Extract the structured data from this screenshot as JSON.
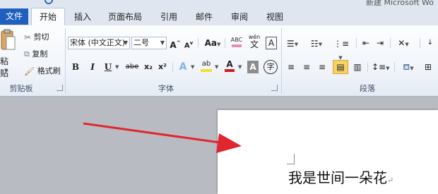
{
  "window": {
    "title": "新建 Microsoft Wo"
  },
  "tabs": [
    {
      "label": "文件"
    },
    {
      "label": "开始"
    },
    {
      "label": "插入"
    },
    {
      "label": "页面布局"
    },
    {
      "label": "引用"
    },
    {
      "label": "邮件"
    },
    {
      "label": "审阅"
    },
    {
      "label": "视图"
    }
  ],
  "clipboard": {
    "paste_label": "粘贴",
    "cut": "剪切",
    "copy": "复制",
    "format_painter": "格式刷",
    "group_label": "剪贴板"
  },
  "font": {
    "font_name": "宋体 (中文正文)",
    "font_size": "二号",
    "grow": "A",
    "shrink": "A",
    "change_case": "Aa",
    "clear_format": "ABC",
    "phonetic": "wén",
    "border_char": "A",
    "bold": "B",
    "italic": "I",
    "underline": "U",
    "strike": "abe",
    "subscript": "x₂",
    "superscript": "x²",
    "text_effect": "A",
    "highlight": "ab",
    "font_color": "A",
    "char_shading": "A",
    "enclose_char": "字",
    "group_label": "字体"
  },
  "paragraph": {
    "group_label": "段落"
  },
  "document": {
    "text": "我是世间一朵花",
    "para_mark": "↵"
  },
  "colors": {
    "file_tab": "#1f5fbf",
    "highlight_yellow": "#f4e12a",
    "font_red": "#d01c1c",
    "arrow_red": "#e0262e"
  }
}
